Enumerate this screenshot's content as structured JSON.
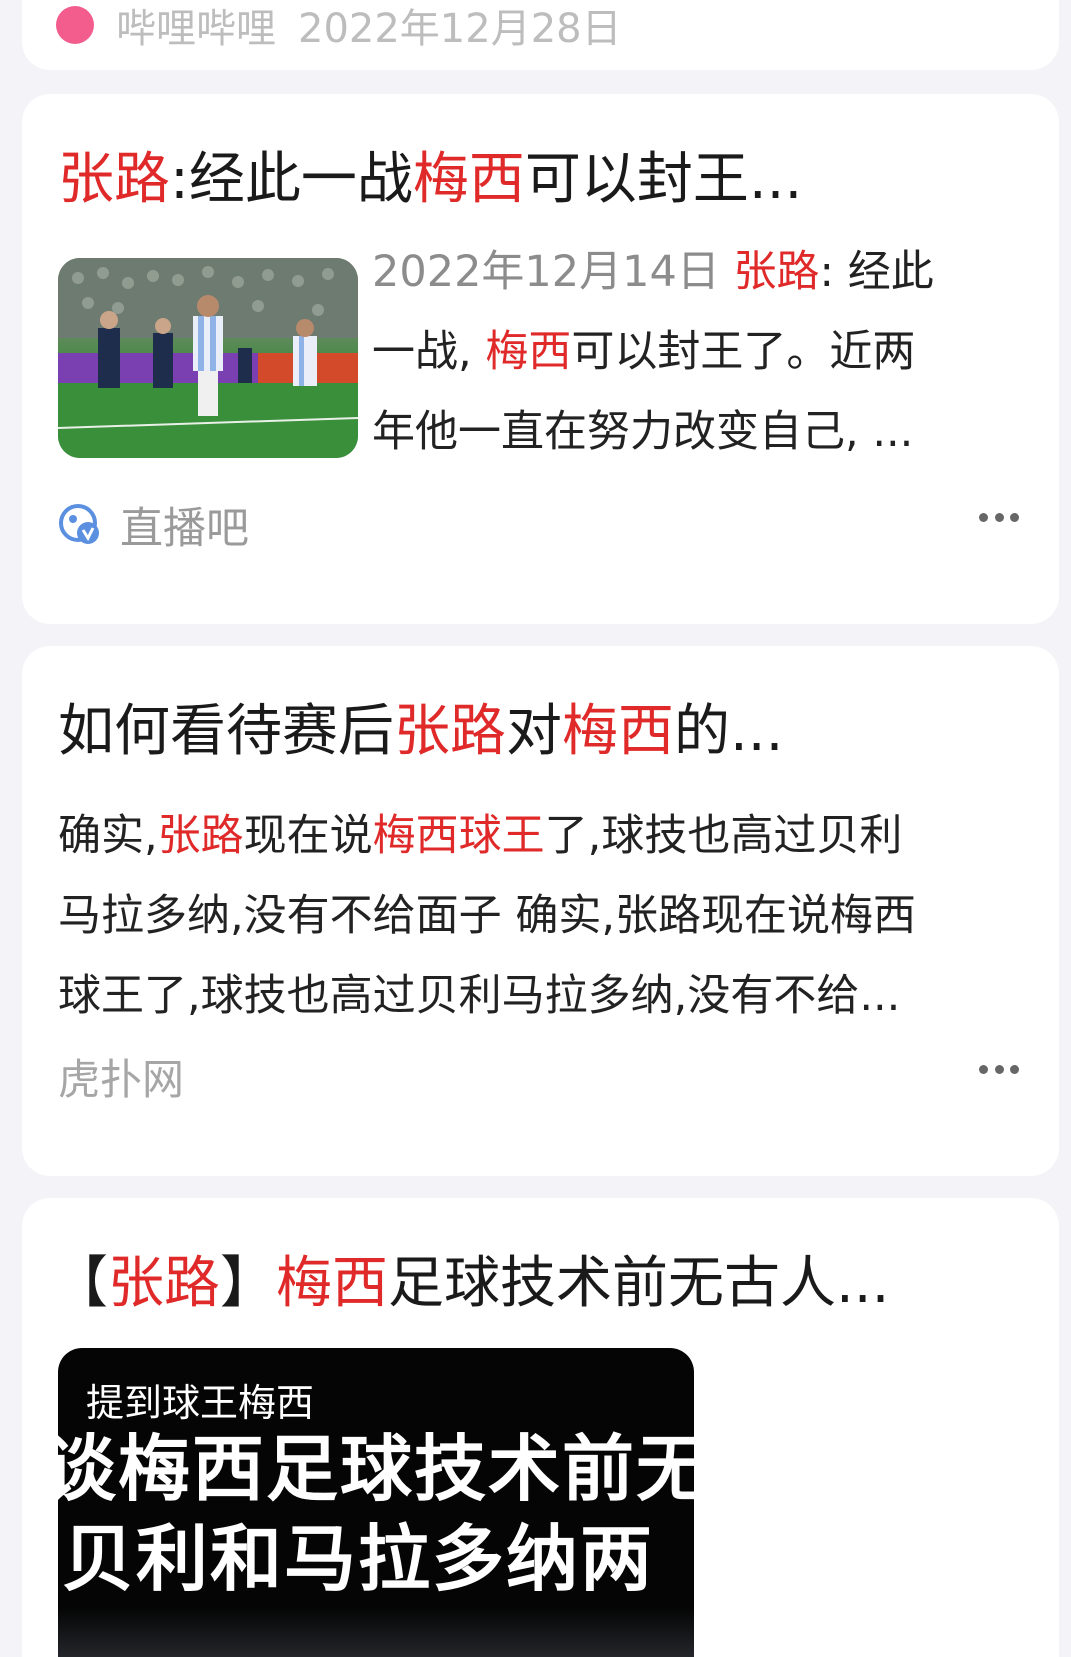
{
  "top_card": {
    "source": "哔哩哔哩",
    "date": "2022年12月28日"
  },
  "card1": {
    "title_parts": [
      "张路",
      ":经此一战",
      "梅西",
      "可以封王..."
    ],
    "snippet_lines": [
      [
        "2022年12月14日 ",
        "张路",
        ": 经此"
      ],
      [
        "一战, ",
        "梅西",
        "可以封王了。近两"
      ],
      [
        "年他一直在努力改变自己, ..."
      ]
    ],
    "source": "直播吧",
    "source_icon": "zhibo8-logo-icon"
  },
  "card2": {
    "title_parts": [
      "如何看待赛后",
      "张路",
      "对",
      "梅西",
      "的..."
    ],
    "snippet_lines": [
      [
        "确实,",
        "张路",
        "现在说",
        "梅西球王",
        "了,球技也高过贝利"
      ],
      [
        "马拉多纳,没有不给面子 确实,张路现在说梅西"
      ],
      [
        "球王了,球技也高过贝利马拉多纳,没有不给..."
      ]
    ],
    "source": "虎扑网"
  },
  "card3": {
    "title_parts": [
      "【",
      "张路",
      "】",
      "梅西",
      "足球技术前无古人..."
    ],
    "video_caption": "提到球王梅西",
    "video_subtitle_lines": [
      "谈梅西足球技术前无",
      "贝利和马拉多纳两"
    ]
  },
  "colors": {
    "highlight": "#e02a2a",
    "meta_gray": "#9a9a9a",
    "page_bg": "#f4f4f8"
  }
}
